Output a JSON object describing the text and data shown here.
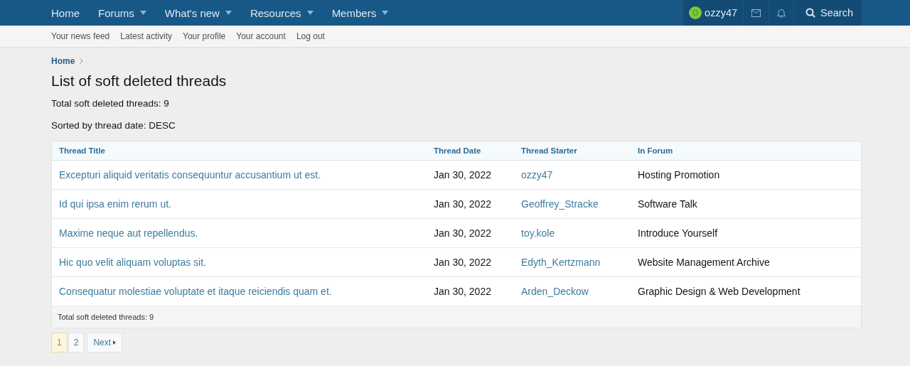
{
  "nav": {
    "items": [
      {
        "label": "Home",
        "dropdown": false
      },
      {
        "label": "Forums",
        "dropdown": true
      },
      {
        "label": "What's new",
        "dropdown": true
      },
      {
        "label": "Resources",
        "dropdown": true
      },
      {
        "label": "Members",
        "dropdown": true
      }
    ],
    "user": {
      "avatar_letter": "O",
      "name": "ozzy47"
    },
    "search": "Search"
  },
  "subnav": [
    "Your news feed",
    "Latest activity",
    "Your profile",
    "Your account",
    "Log out"
  ],
  "breadcrumb": [
    "Home"
  ],
  "title": "List of soft deleted threads",
  "info": [
    "Total soft deleted threads: 9",
    "Sorted by thread date: DESC"
  ],
  "table": {
    "columns": [
      "Thread Title",
      "Thread Date",
      "Thread Starter",
      "In Forum"
    ],
    "rows": [
      [
        "Excepturi aliquid veritatis consequuntur accusantium ut est.",
        "Jan 30, 2022",
        "ozzy47",
        "Hosting Promotion"
      ],
      [
        "Id qui ipsa enim rerum ut.",
        "Jan 30, 2022",
        "Geoffrey_Stracke",
        "Software Talk"
      ],
      [
        "Maxime neque aut repellendus.",
        "Jan 30, 2022",
        "toy.kole",
        "Introduce Yourself"
      ],
      [
        "Hic quo velit aliquam voluptas sit.",
        "Jan 30, 2022",
        "Edyth_Kertzmann",
        "Website Management Archive"
      ],
      [
        "Consequatur molestiae voluptate et itaque reiciendis quam et.",
        "Jan 30, 2022",
        "Arden_Deckow",
        "Graphic Design & Web Development"
      ]
    ],
    "footer": "Total soft deleted threads: 9"
  },
  "pagination": {
    "pages": [
      {
        "label": "1",
        "selected": true
      },
      {
        "label": "2",
        "selected": false
      }
    ],
    "next": "Next"
  }
}
